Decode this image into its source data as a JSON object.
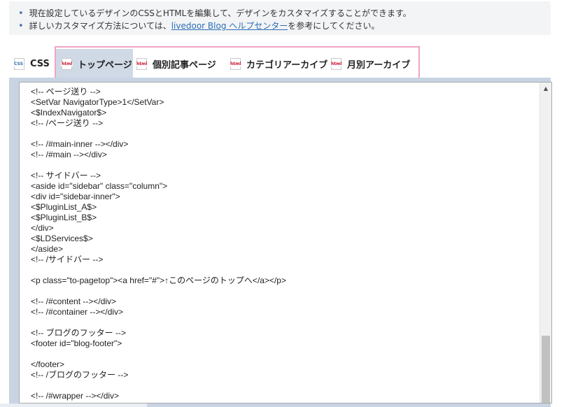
{
  "info": {
    "line1": "現在設定しているデザインのCSSとHTMLを編集して、デザインをカスタマイズすることができます。",
    "line2_before": "詳しいカスタマイズ方法については、",
    "line2_link": "livedoor Blog ヘルプセンター",
    "line2_after": "を参考にしてください。"
  },
  "tabs": [
    {
      "label": "CSS",
      "icon": "css-file-icon",
      "icon_text": "CSS",
      "active": false
    },
    {
      "label": "トップページ",
      "icon": "html-file-icon",
      "icon_text": "html",
      "active": true
    },
    {
      "label": "個別記事ページ",
      "icon": "html-file-icon",
      "icon_text": "html",
      "active": false
    },
    {
      "label": "カテゴリアーカイブ",
      "icon": "html-file-icon",
      "icon_text": "html",
      "active": false
    },
    {
      "label": "月別アーカイブ",
      "icon": "html-file-icon",
      "icon_text": "html",
      "active": false
    }
  ],
  "editor": {
    "content": "<!-- ページ送り -->\n<SetVar NavigatorType>1</SetVar>\n<$IndexNavigator$>\n<!-- /ページ送り -->\n\n<!-- /#main-inner --></div>\n<!-- /#main --></div>\n\n<!-- サイドバー -->\n<aside id=\"sidebar\" class=\"column\">\n<div id=\"sidebar-inner\">\n<$PluginList_A$>\n<$PluginList_B$>\n</div>\n<$LDServices$>\n</aside>\n<!-- /サイドバー -->\n\n<p class=\"to-pagetop\"><a href=\"#\">↑このページのトップへ</a></p>\n\n<!-- /#content --></div>\n<!-- /#container --></div>\n\n<!-- ブログのフッター -->\n<footer id=\"blog-footer\">\n\n</footer>\n<!-- /ブログのフッター -->\n\n<!-- /#wrapper --></div>",
    "scroll_up_glyph": "▲"
  },
  "colors": {
    "accent_link": "#2a6eb5",
    "active_tab_bg": "#d0d9e6",
    "highlight_border": "#f1a3c6",
    "html_icon_red": "#c8102e"
  }
}
